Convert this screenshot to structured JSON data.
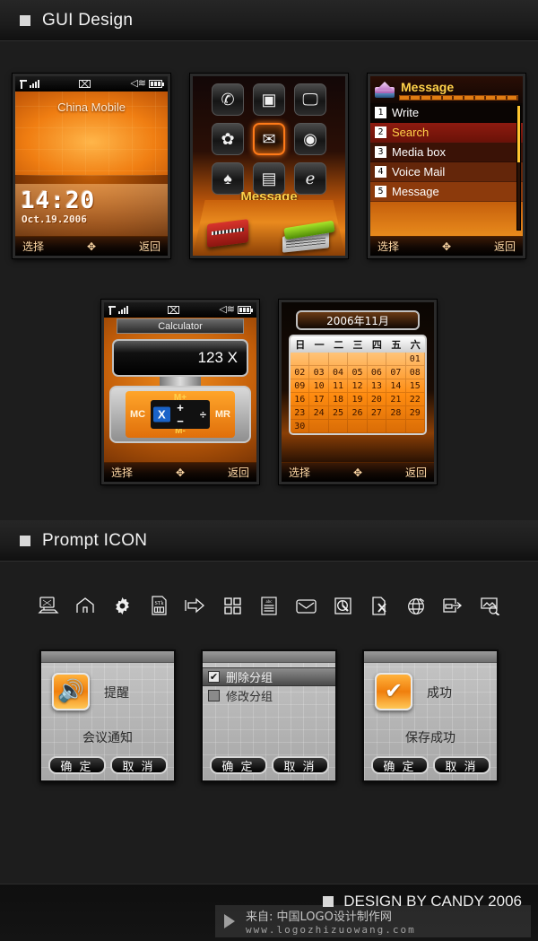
{
  "sections": {
    "gui_design": {
      "title": "GUI Design",
      "bullet": "square-bullet"
    },
    "prompt_icon": {
      "title": "Prompt ICON",
      "bullet": "square-bullet"
    }
  },
  "softkeys": {
    "left": "选择",
    "center": "nav-cross",
    "right": "返回"
  },
  "statusbar": {
    "signal": "signal-bars-icon",
    "message": "envelope-icon",
    "sound": "speaker-icon",
    "battery": "battery-icon"
  },
  "screen_standby": {
    "operator": "China Mobile",
    "time": "14:20",
    "date": "Oct.19.2006"
  },
  "screen_mainmenu": {
    "label": "Message",
    "icons": [
      {
        "name": "contacts-icon",
        "glyph": "✆"
      },
      {
        "name": "multimedia-icon",
        "glyph": "▣"
      },
      {
        "name": "display-icon",
        "glyph": "🖵"
      },
      {
        "name": "settings-icon",
        "glyph": "✿"
      },
      {
        "name": "message-icon",
        "glyph": "✉",
        "selected": true
      },
      {
        "name": "media-player-icon",
        "glyph": "◉"
      },
      {
        "name": "games-icon",
        "glyph": "♠"
      },
      {
        "name": "organizer-icon",
        "glyph": "▤"
      },
      {
        "name": "internet-icon",
        "glyph": "ℯ"
      }
    ]
  },
  "screen_message": {
    "title": "Message",
    "header_icon": "mail-stack-icon",
    "items": [
      {
        "num": "1",
        "label": "Write",
        "selected": false
      },
      {
        "num": "2",
        "label": "Search",
        "selected": true
      },
      {
        "num": "3",
        "label": "Media box",
        "selected": false
      },
      {
        "num": "4",
        "label": "Voice Mail",
        "selected": false
      },
      {
        "num": "5",
        "label": "Message",
        "selected": false
      }
    ]
  },
  "screen_calculator": {
    "title": "Calculator",
    "display": "123 X",
    "keys": {
      "mplus": "M+",
      "mminus": "M-",
      "mc": "MC",
      "mr": "MR",
      "multiply": "X",
      "divide": "÷",
      "plus": "+",
      "minus": "−"
    }
  },
  "screen_calendar": {
    "year_month": "2006年11月",
    "weekdays": [
      "日",
      "一",
      "二",
      "三",
      "四",
      "五",
      "六"
    ],
    "blanks": 6,
    "days": [
      "01",
      "02",
      "03",
      "04",
      "05",
      "06",
      "07",
      "08",
      "09",
      "10",
      "11",
      "12",
      "13",
      "14",
      "15",
      "16",
      "17",
      "18",
      "19",
      "20",
      "21",
      "22",
      "23",
      "24",
      "25",
      "26",
      "27",
      "28",
      "29",
      "30"
    ]
  },
  "prompt_icons": [
    {
      "name": "computer-icon"
    },
    {
      "name": "home-icon"
    },
    {
      "name": "gear-icon"
    },
    {
      "name": "stk-card-icon",
      "label": "STK"
    },
    {
      "name": "arrow-right-icon"
    },
    {
      "name": "grid-view-icon"
    },
    {
      "name": "abc-list-icon",
      "label": "ABC"
    },
    {
      "name": "envelope-icon"
    },
    {
      "name": "cursor-select-icon"
    },
    {
      "name": "delete-page-icon"
    },
    {
      "name": "globe-icon"
    },
    {
      "name": "export-icon"
    },
    {
      "name": "image-search-icon"
    }
  ],
  "dialogs": [
    {
      "name": "reminder-dialog",
      "icon": "speaker-icon",
      "icon_glyph": "🔊",
      "title": "提醒",
      "message": "会议通知",
      "ok": "确 定",
      "cancel": "取 消"
    },
    {
      "name": "group-options-dialog",
      "options": [
        {
          "label": "删除分组",
          "checked": true,
          "selected": true
        },
        {
          "label": "修改分组",
          "checked": false,
          "selected": false
        }
      ],
      "ok": "确 定",
      "cancel": "取 消"
    },
    {
      "name": "success-dialog",
      "icon": "checkmark-icon",
      "icon_glyph": "✔",
      "title": "成功",
      "message": "保存成功",
      "ok": "确 定",
      "cancel": "取 消"
    }
  ],
  "footer": {
    "credit": "DESIGN BY CANDY 2006",
    "watermark_line1": "来自: 中国LOGO设计制作网",
    "watermark_line2": "www.logozhizuowang.com"
  }
}
